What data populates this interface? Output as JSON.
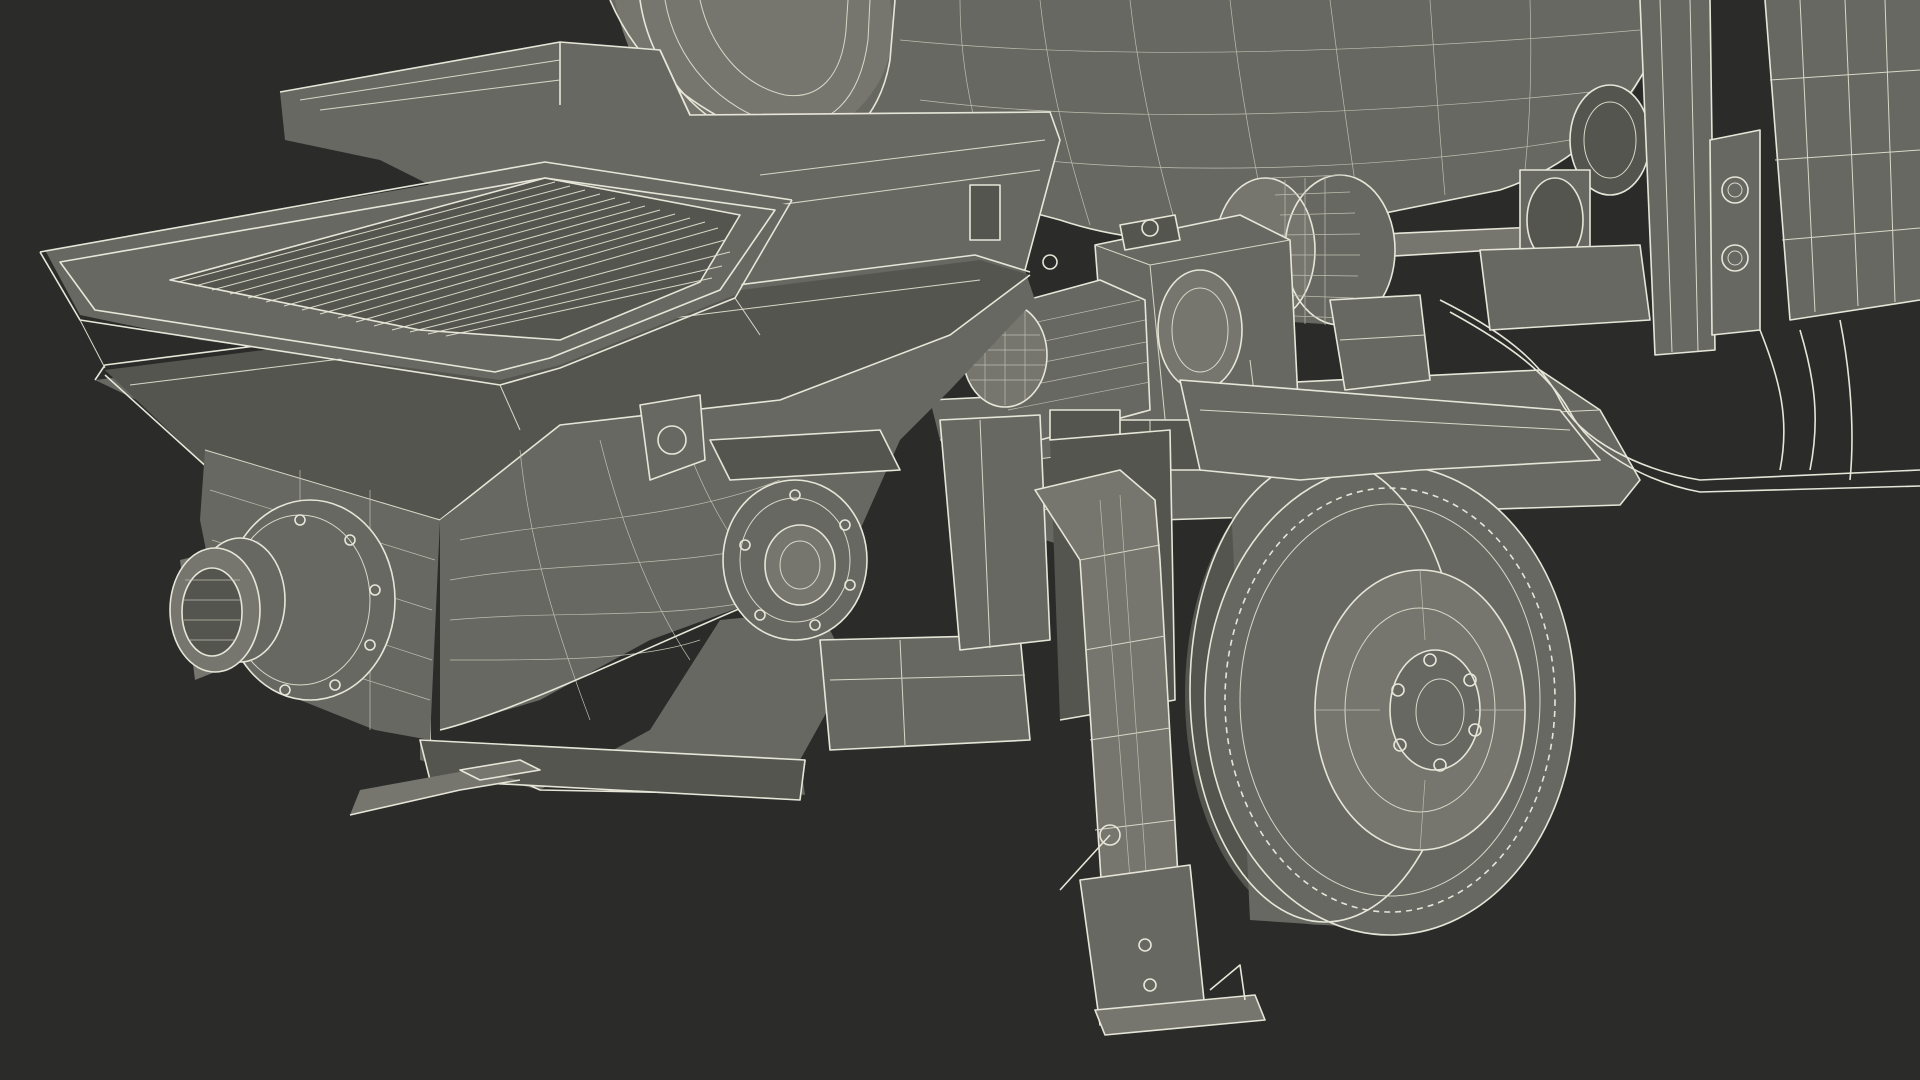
{
  "scene": {
    "background": "#2b2b2a",
    "surface": "#686863",
    "wireframe": "#e6e6d8",
    "objects": [
      {
        "icon": "mixer-drum-icon"
      },
      {
        "icon": "hopper-icon"
      },
      {
        "icon": "pump-outlet-icon"
      },
      {
        "icon": "electric-motor-icon"
      },
      {
        "icon": "gearbox-icon"
      },
      {
        "icon": "drive-shaft-icon"
      },
      {
        "icon": "support-leg-icon"
      },
      {
        "icon": "wheel-icon"
      },
      {
        "icon": "control-box-icon"
      }
    ]
  }
}
